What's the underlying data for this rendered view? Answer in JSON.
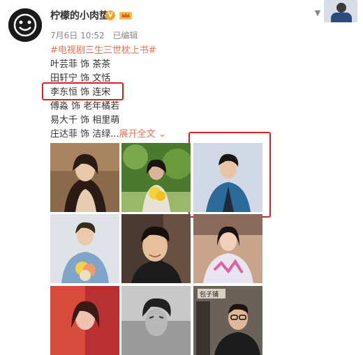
{
  "post": {
    "author": "柠檬的小肉垫",
    "verified_badge": "V",
    "date": "7月6日 10:52",
    "edited": "已编辑",
    "hashtag": "#电视剧三生三世枕上书#",
    "lines": [
      "叶芸菲 饰 茶茶",
      "田轩宁 饰 文恬",
      "李东恒 饰 连宋",
      "傅淼 饰 老年橘若",
      "易大千 饰 相里萌",
      "庄达菲 饰 洁绿..."
    ],
    "expand_label": "展开全文",
    "expand_icon": "chevron-down-icon"
  },
  "colors": {
    "accent": "#eb7350",
    "highlight": "#e02020",
    "verified": "#f5a623"
  },
  "photos": [
    {
      "name": "photo-1",
      "desc_icon": "portrait"
    },
    {
      "name": "photo-2",
      "desc_icon": "portrait"
    },
    {
      "name": "photo-3",
      "desc_icon": "portrait"
    },
    {
      "name": "photo-4",
      "desc_icon": "portrait"
    },
    {
      "name": "photo-5",
      "desc_icon": "portrait"
    },
    {
      "name": "photo-6",
      "desc_icon": "portrait"
    },
    {
      "name": "photo-7",
      "desc_icon": "portrait"
    },
    {
      "name": "photo-8",
      "desc_icon": "portrait"
    },
    {
      "name": "photo-9",
      "desc_icon": "portrait"
    }
  ],
  "photo9_sign": "包子铺"
}
